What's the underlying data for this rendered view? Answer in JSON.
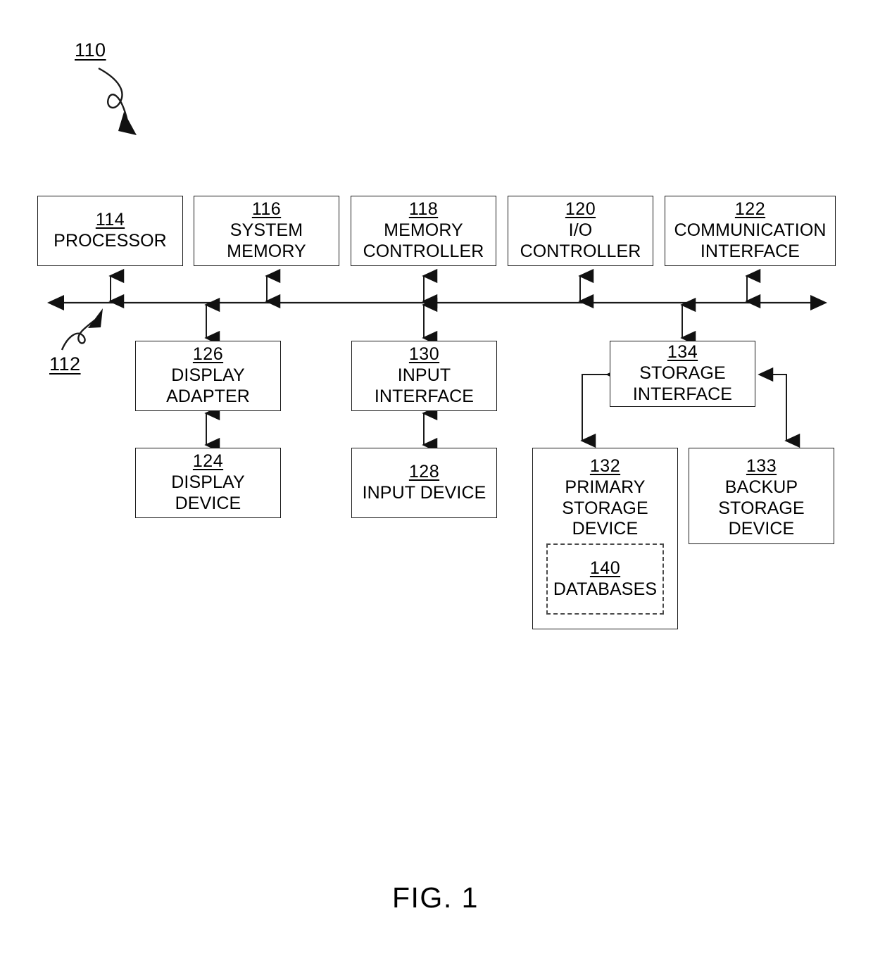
{
  "figure": {
    "caption": "FIG. 1",
    "system_tag": "110",
    "bus_tag": "112"
  },
  "nodes": {
    "processor": {
      "ref": "114",
      "label": "PROCESSOR"
    },
    "system_memory": {
      "ref": "116",
      "label": "SYSTEM\nMEMORY"
    },
    "memory_controller": {
      "ref": "118",
      "label": "MEMORY\nCONTROLLER"
    },
    "io_controller": {
      "ref": "120",
      "label": "I/O\nCONTROLLER"
    },
    "comm_interface": {
      "ref": "122",
      "label": "COMMUNICATION\nINTERFACE"
    },
    "display_adapter": {
      "ref": "126",
      "label": "DISPLAY\nADAPTER"
    },
    "input_interface": {
      "ref": "130",
      "label": "INPUT\nINTERFACE"
    },
    "storage_interface": {
      "ref": "134",
      "label": "STORAGE\nINTERFACE"
    },
    "display_device": {
      "ref": "124",
      "label": "DISPLAY\nDEVICE"
    },
    "input_device": {
      "ref": "128",
      "label": "INPUT DEVICE"
    },
    "primary_storage": {
      "ref": "132",
      "label": "PRIMARY\nSTORAGE\nDEVICE"
    },
    "backup_storage": {
      "ref": "133",
      "label": "BACKUP\nSTORAGE\nDEVICE"
    },
    "databases": {
      "ref": "140",
      "label": "DATABASES"
    }
  },
  "colors": {
    "stroke": "#1a1a1a",
    "dashed_stroke": "#4a4a4a",
    "background": "#ffffff"
  }
}
